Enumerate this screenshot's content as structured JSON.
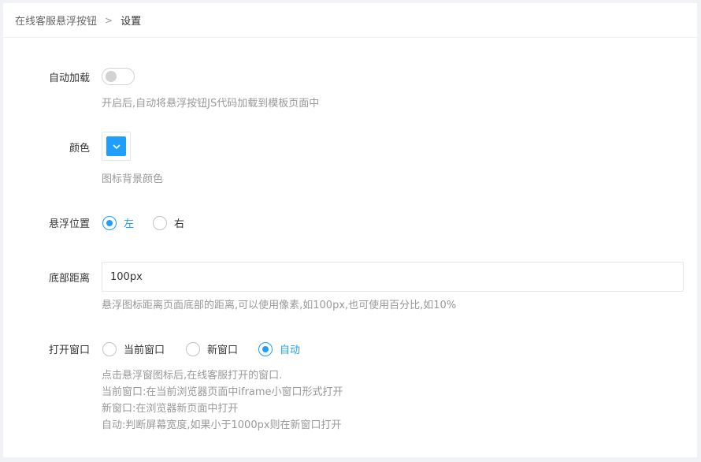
{
  "breadcrumb": {
    "parent": "在线客服悬浮按钮",
    "separator": ">",
    "current": "设置"
  },
  "auto_load": {
    "label": "自动加载",
    "enabled": false,
    "hint": "开启后,自动将悬浮按钮JS代码加载到模板页面中"
  },
  "color": {
    "label": "颜色",
    "value": "#1e9fff",
    "icon": "chevron-down-icon",
    "hint": "图标背景颜色"
  },
  "position": {
    "label": "悬浮位置",
    "options": [
      {
        "label": "左",
        "checked": true
      },
      {
        "label": "右",
        "checked": false
      }
    ]
  },
  "bottom_distance": {
    "label": "底部距离",
    "value": "100px",
    "hint": "悬浮图标距离页面底部的距离,可以使用像素,如100px,也可使用百分比,如10%"
  },
  "open_window": {
    "label": "打开窗口",
    "options": [
      {
        "label": "当前窗口",
        "checked": false
      },
      {
        "label": "新窗口",
        "checked": false
      },
      {
        "label": "自动",
        "checked": true
      }
    ],
    "hints": [
      "点击悬浮窗图标后,在线客服打开的窗口.",
      "当前窗口:在当前浏览器页面中iframe小窗口形式打开",
      "新窗口:在浏览器新页面中打开",
      "自动:判断屏幕宽度,如果小于1000px则在新窗口打开"
    ]
  },
  "colors": {
    "accent": "#1e9fff",
    "hint_text": "#999999"
  }
}
